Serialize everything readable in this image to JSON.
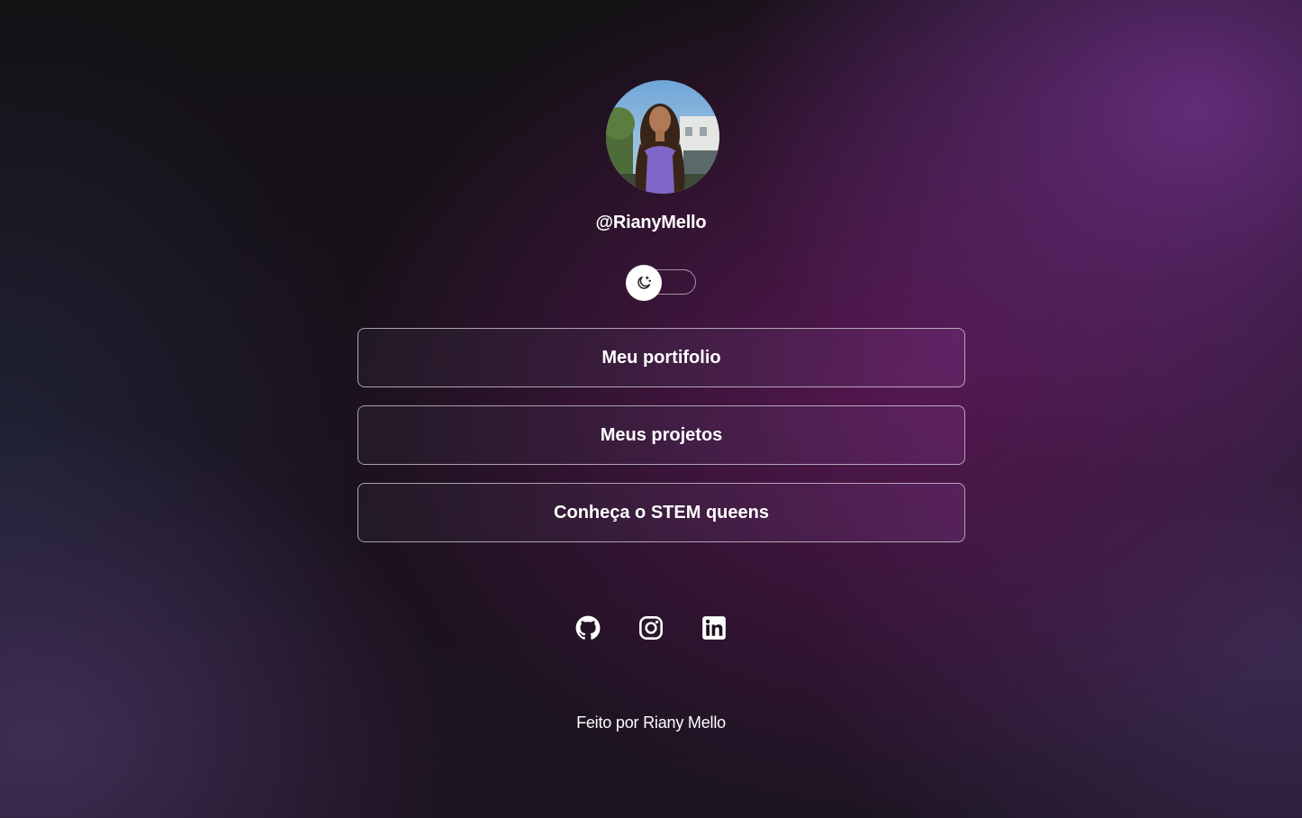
{
  "profile": {
    "username": "@RianyMello",
    "avatar_icon": "profile-photo"
  },
  "theme_toggle": {
    "icon": "moon-sun-icon",
    "state": "dark"
  },
  "links": [
    {
      "label": "Meu portifolio"
    },
    {
      "label": "Meus projetos"
    },
    {
      "label": "Conheça o STEM queens"
    }
  ],
  "socials": [
    {
      "name": "github",
      "icon": "github-icon"
    },
    {
      "name": "instagram",
      "icon": "instagram-icon"
    },
    {
      "name": "linkedin",
      "icon": "linkedin-icon"
    }
  ],
  "footer": {
    "text": "Feito por Riany Mello"
  },
  "colors": {
    "accent_purple": "#6e3087",
    "background_dark": "#151216",
    "text": "#ffffff"
  }
}
